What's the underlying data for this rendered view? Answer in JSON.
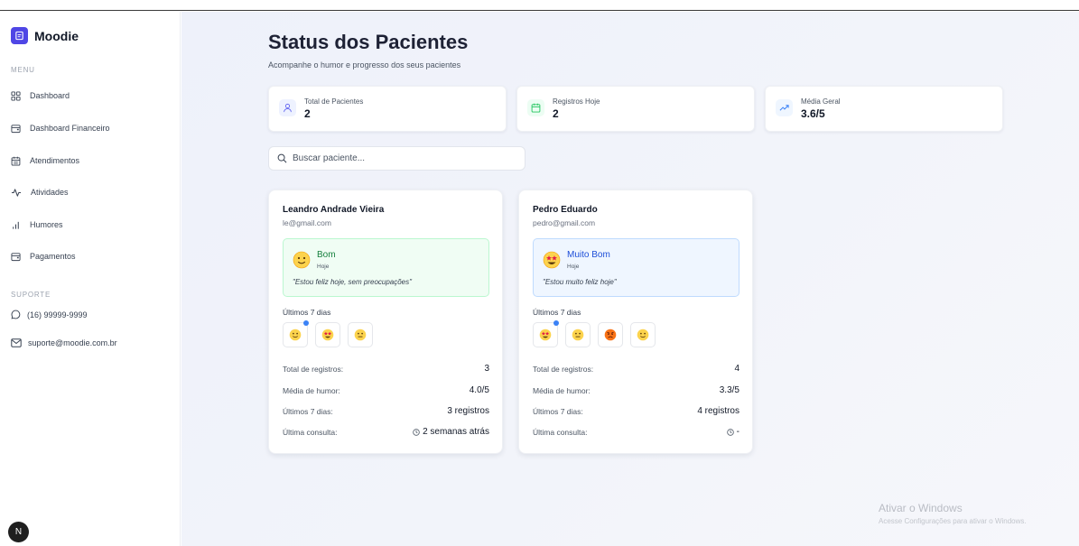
{
  "app": {
    "name": "Moodie"
  },
  "sidebar": {
    "menu_label": "MENU",
    "items": [
      {
        "label": "Dashboard",
        "icon": "grid-icon"
      },
      {
        "label": "Dashboard Financeiro",
        "icon": "wallet-icon"
      },
      {
        "label": "Atendimentos",
        "icon": "calendar-icon"
      },
      {
        "label": "Atividades",
        "icon": "activity-icon"
      },
      {
        "label": "Humores",
        "icon": "bar-chart-icon"
      },
      {
        "label": "Pagamentos",
        "icon": "wallet-icon"
      }
    ],
    "support_label": "SUPORTE",
    "support": {
      "phone": "(16) 99999-9999",
      "email": "suporte@moodie.com.br"
    },
    "avatar_letter": "N"
  },
  "header": {
    "title": "Status dos Pacientes",
    "subtitle": "Acompanhe o humor e progresso dos seus pacientes"
  },
  "stats": [
    {
      "label": "Total de Pacientes",
      "value": "2",
      "icon": "user-icon",
      "color": "#6366f1"
    },
    {
      "label": "Registros Hoje",
      "value": "2",
      "icon": "calendar-icon",
      "color": "#22c55e"
    },
    {
      "label": "Média Geral",
      "value": "3.6/5",
      "icon": "trending-up-icon",
      "color": "#3b82f6"
    }
  ],
  "search": {
    "placeholder": "Buscar paciente..."
  },
  "patients": [
    {
      "name": "Leandro Andrade Vieira",
      "email": "le@gmail.com",
      "mood": {
        "label": "Bom",
        "when": "Hoje",
        "quote": "\"Estou feliz hoje, sem preocupações\""
      },
      "last7_label": "Últimos 7 dias",
      "recent": [
        "slight-smile",
        "star-struck",
        "neutral"
      ],
      "rows": [
        {
          "k": "Total de registros:",
          "v": "3"
        },
        {
          "k": "Média de humor:",
          "v": "4.0/5"
        },
        {
          "k": "Últimos 7 dias:",
          "v": "3 registros"
        },
        {
          "k": "Última consulta:",
          "v": "2 semanas atrás"
        }
      ]
    },
    {
      "name": "Pedro Eduardo",
      "email": "pedro@gmail.com",
      "mood": {
        "label": "Muito Bom",
        "when": "Hoje",
        "quote": "\"Estou muito feliz hoje\""
      },
      "last7_label": "Últimos 7 dias",
      "recent": [
        "star-struck",
        "neutral",
        "angry",
        "slight-smile"
      ],
      "rows": [
        {
          "k": "Total de registros:",
          "v": "4"
        },
        {
          "k": "Média de humor:",
          "v": "3.3/5"
        },
        {
          "k": "Últimos 7 dias:",
          "v": "4 registros"
        },
        {
          "k": "Última consulta:",
          "v": "-"
        }
      ]
    }
  ],
  "watermark": {
    "title": "Ativar o Windows",
    "subtitle": "Acesse Configurações para ativar o Windows."
  }
}
